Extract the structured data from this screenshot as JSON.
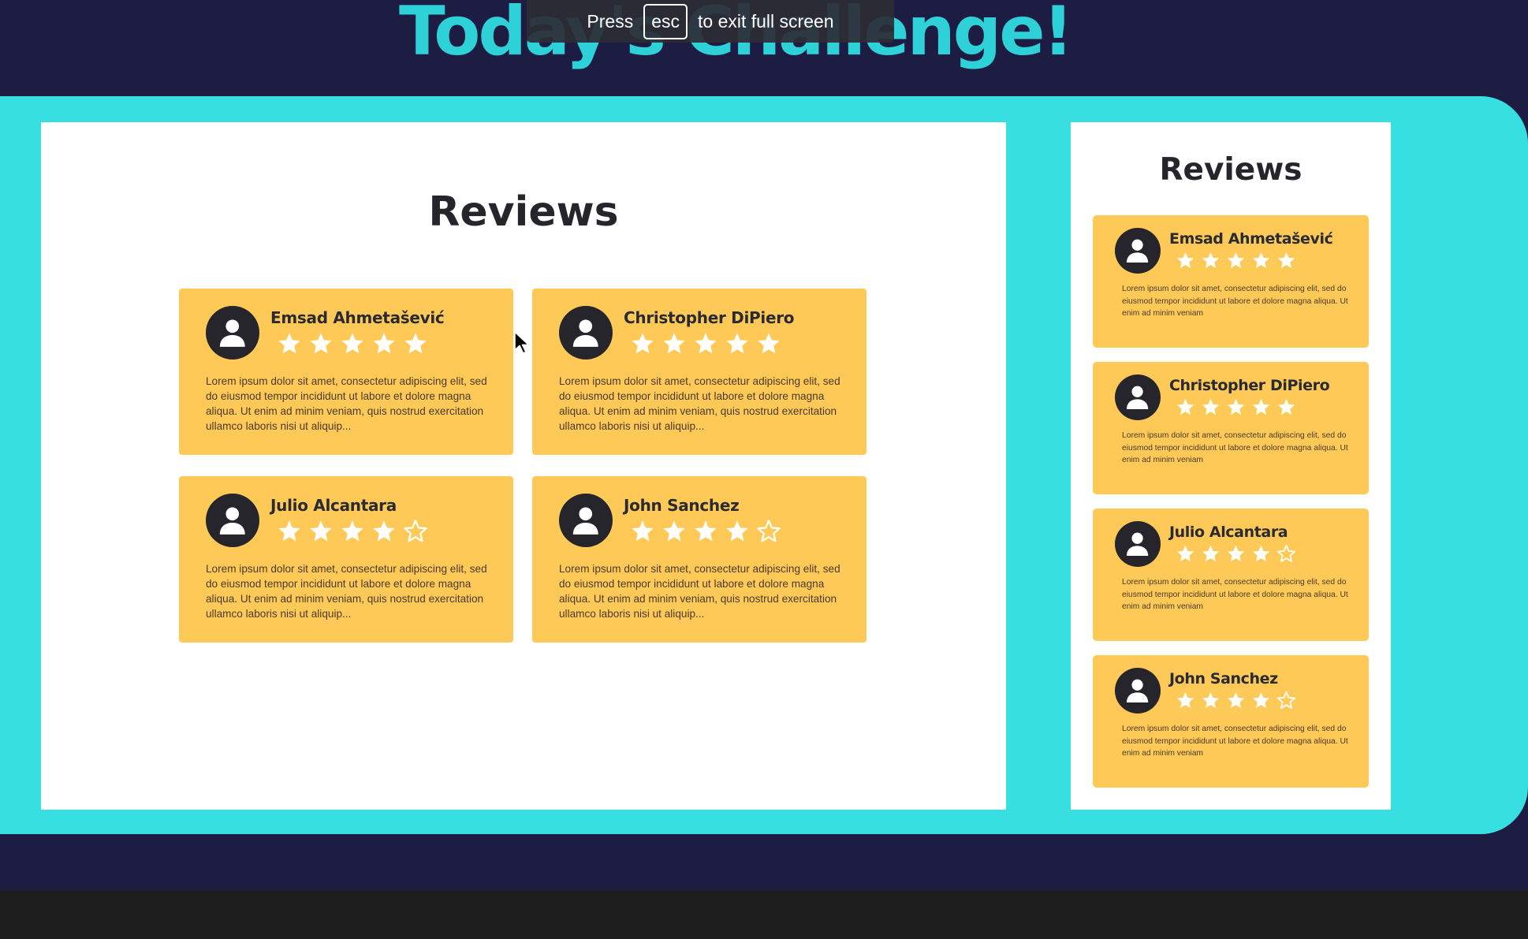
{
  "colors": {
    "background": "#1d1c43",
    "accent": "#37dfe1",
    "panel": "#ffffff",
    "card": "#fec957",
    "ink": "#25252b",
    "star": "#ffffff"
  },
  "header": {
    "title": "Today's Challenge!"
  },
  "fullscreen_notice": {
    "before": "Press",
    "key": "esc",
    "after": "to exit full screen"
  },
  "desktop": {
    "heading": "Reviews",
    "reviews": [
      {
        "name": "Emsad Ahmetašević",
        "rating": 5,
        "text": "Lorem ipsum dolor sit amet, consectetur adipiscing elit, sed do eiusmod tempor incididunt ut labore et dolore magna aliqua. Ut enim ad minim veniam, quis nostrud exercitation ullamco laboris nisi ut aliquip..."
      },
      {
        "name": "Christopher DiPiero",
        "rating": 5,
        "text": "Lorem ipsum dolor sit amet, consectetur adipiscing elit, sed do eiusmod tempor incididunt ut labore et dolore magna aliqua. Ut enim ad minim veniam, quis nostrud exercitation ullamco laboris nisi ut aliquip..."
      },
      {
        "name": "Julio Alcantara",
        "rating": 4,
        "text": "Lorem ipsum dolor sit amet, consectetur adipiscing elit, sed do eiusmod tempor incididunt ut labore et dolore magna aliqua. Ut enim ad minim veniam, quis nostrud exercitation ullamco laboris nisi ut aliquip..."
      },
      {
        "name": "John Sanchez",
        "rating": 4,
        "text": "Lorem ipsum dolor sit amet, consectetur adipiscing elit, sed do eiusmod tempor incididunt ut labore et dolore magna aliqua. Ut enim ad minim veniam, quis nostrud exercitation ullamco laboris nisi ut aliquip..."
      }
    ]
  },
  "mobile": {
    "heading": "Reviews",
    "reviews": [
      {
        "name": "Emsad Ahmetašević",
        "rating": 5,
        "text": "Lorem ipsum dolor sit amet, consectetur adipiscing elit, sed do eiusmod tempor incididunt ut labore et dolore magna aliqua. Ut enim ad minim veniam"
      },
      {
        "name": "Christopher DiPiero",
        "rating": 5,
        "text": "Lorem ipsum dolor sit amet, consectetur adipiscing elit, sed do eiusmod tempor incididunt ut labore et dolore magna aliqua. Ut enim ad minim veniam"
      },
      {
        "name": "Julio Alcantara",
        "rating": 4,
        "text": "Lorem ipsum dolor sit amet, consectetur adipiscing elit, sed do eiusmod tempor incididunt ut labore et dolore magna aliqua. Ut enim ad minim veniam"
      },
      {
        "name": "John Sanchez",
        "rating": 4,
        "text": "Lorem ipsum dolor sit amet, consectetur adipiscing elit, sed do eiusmod tempor incididunt ut labore et dolore magna aliqua. Ut enim ad minim veniam"
      }
    ]
  },
  "icons": {
    "avatar": "user-avatar-icon",
    "filled_star": "star-filled-icon",
    "empty_star": "star-outline-icon",
    "cursor": "mouse-pointer-icon"
  }
}
